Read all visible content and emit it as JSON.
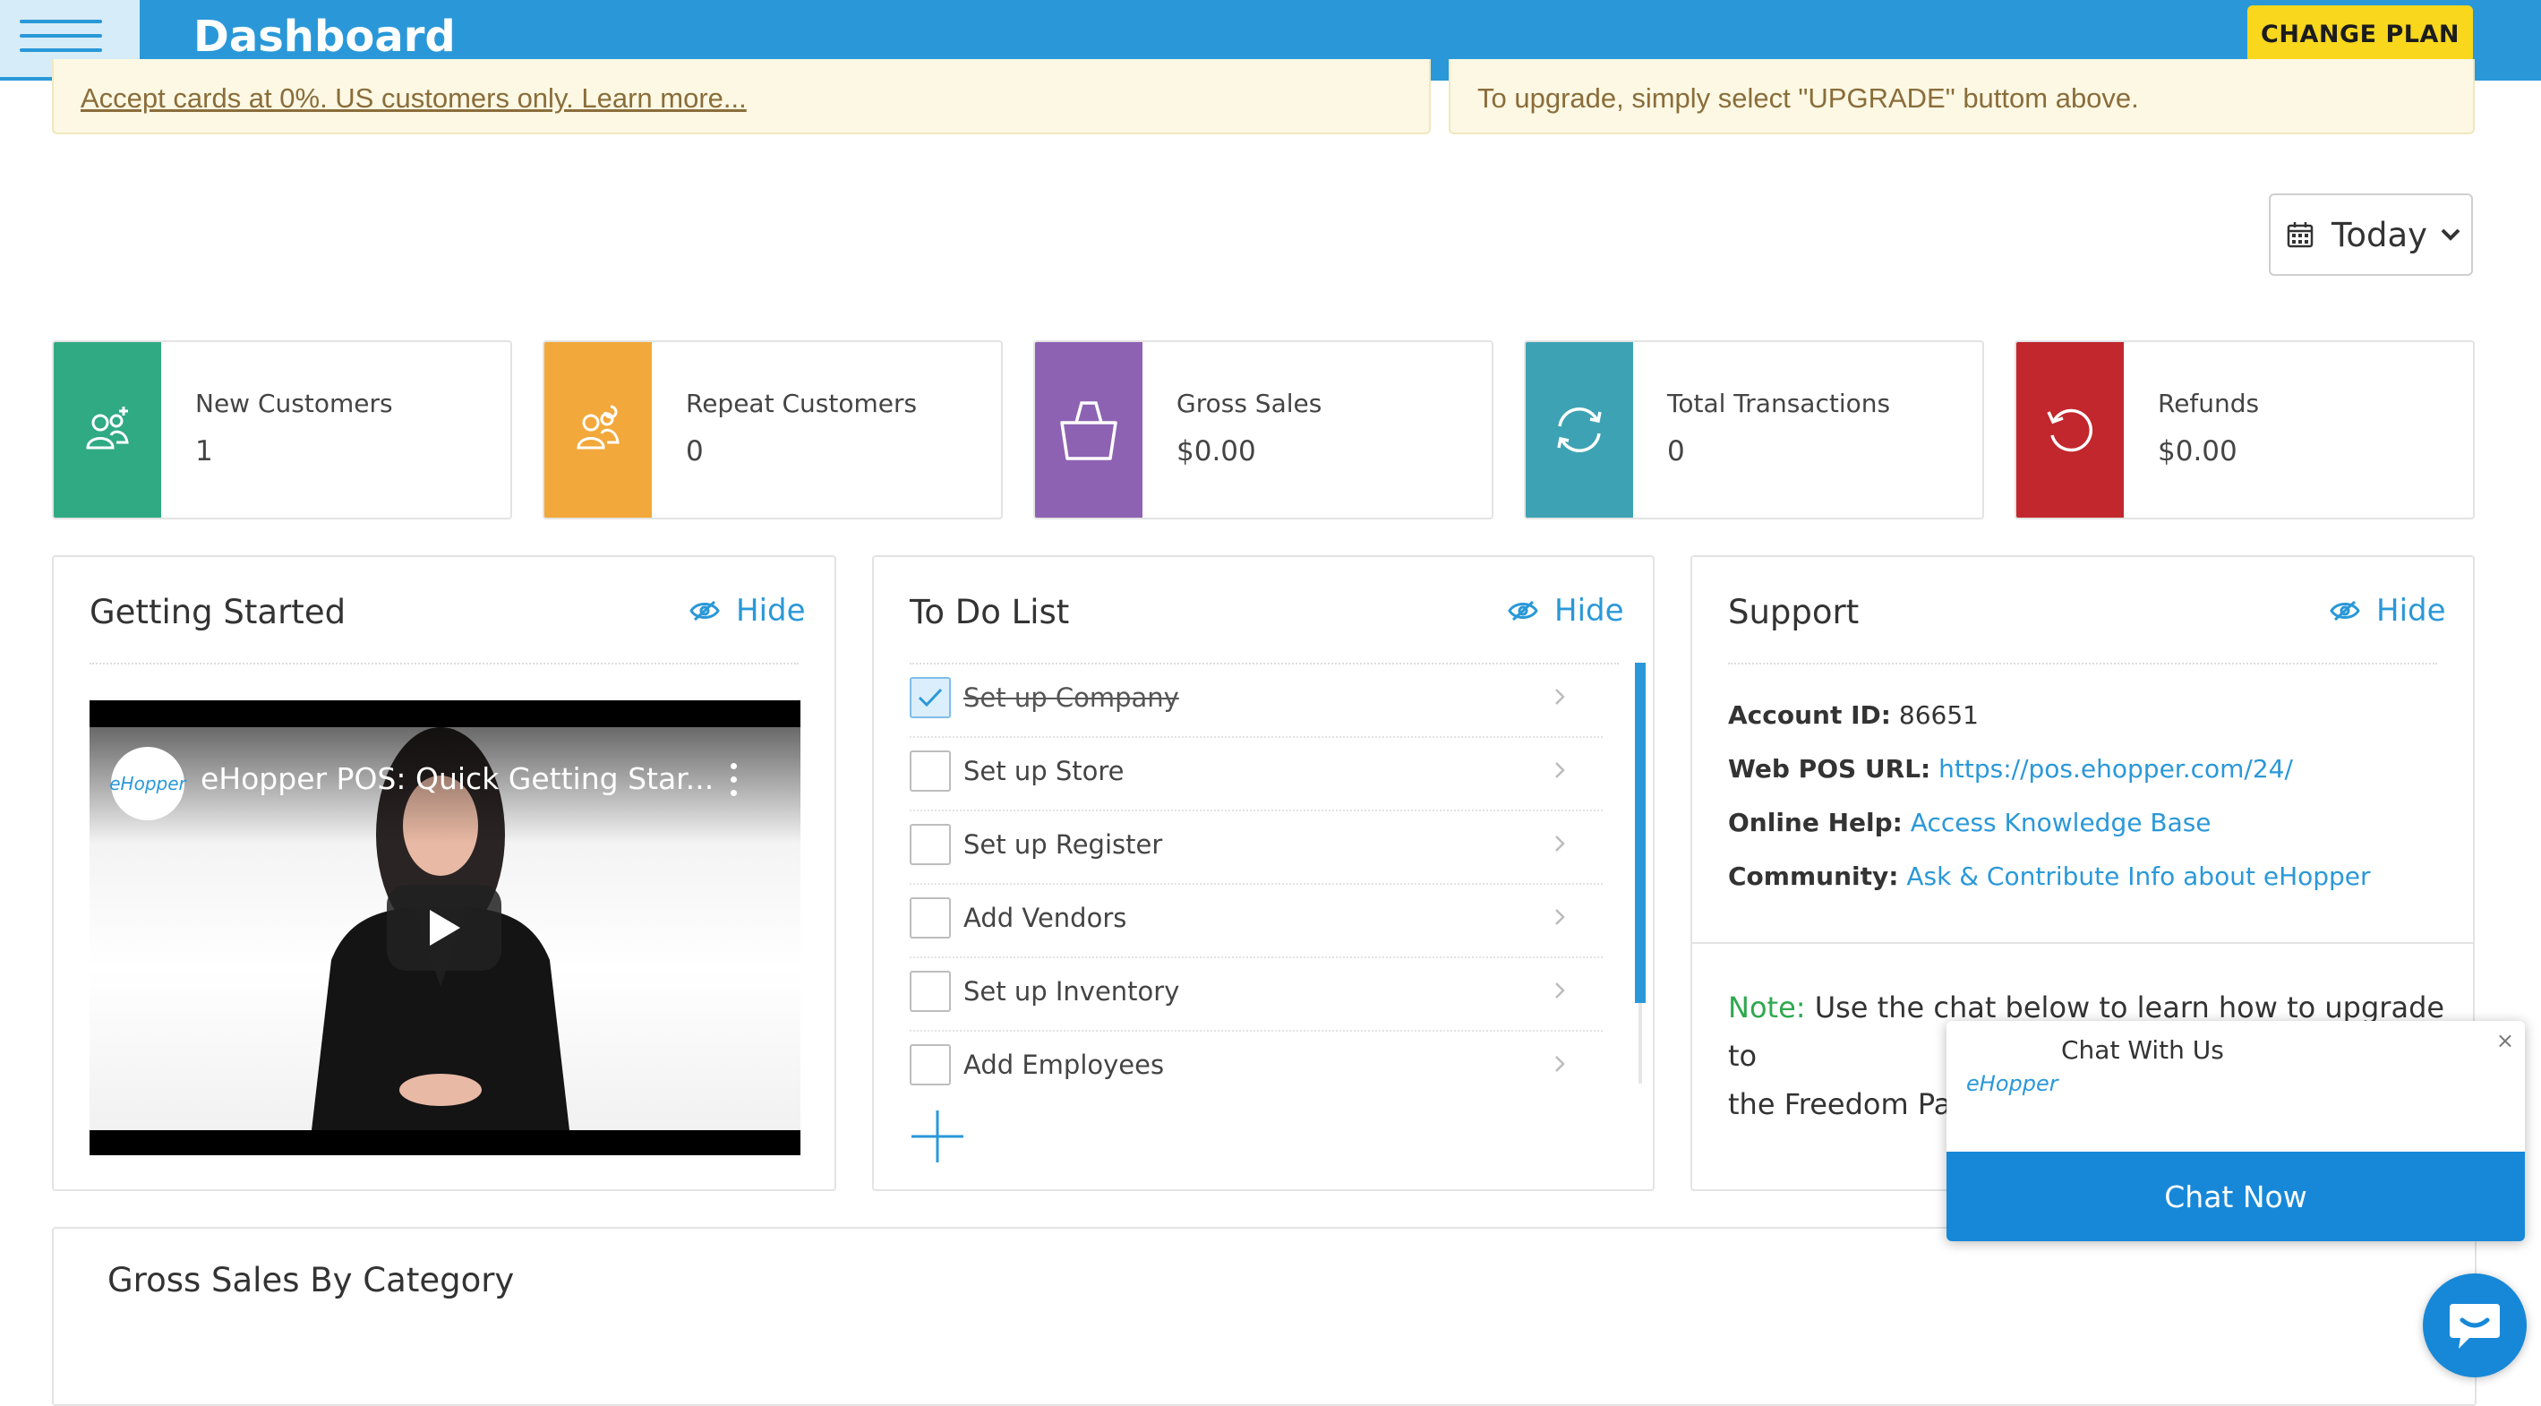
{
  "header": {
    "title": "Dashboard",
    "change_plan_label": "CHANGE PLAN",
    "menu_icon": "hamburger-icon",
    "brand_color": "#2a98d8"
  },
  "notices": {
    "left_text": "Accept cards at 0%. US customers only. Learn more...",
    "right_text": "To upgrade, simply select \"UPGRADE\" buttom above."
  },
  "date_filter": {
    "selected": "Today",
    "icon": "calendar-icon"
  },
  "stats": [
    {
      "label": "New Customers",
      "value": "1",
      "color": "#2faa83",
      "icon": "add-user-icon"
    },
    {
      "label": "Repeat Customers",
      "value": "0",
      "color": "#f2a83a",
      "icon": "users-icon"
    },
    {
      "label": "Gross Sales",
      "value": "$0.00",
      "color": "#8e62b3",
      "icon": "shopping-bag-icon"
    },
    {
      "label": "Total Transactions",
      "value": "0",
      "color": "#3da3b4",
      "icon": "refresh-icon"
    },
    {
      "label": "Refunds",
      "value": "$0.00",
      "color": "#c1272d",
      "icon": "undo-icon"
    }
  ],
  "getting_started": {
    "title": "Getting Started",
    "hide_label": "Hide",
    "video": {
      "channel_logo": "eHopper",
      "title": "eHopper POS: Quick Getting Star..."
    }
  },
  "todo": {
    "title": "To Do List",
    "hide_label": "Hide",
    "items": [
      {
        "label": "Set up Company",
        "done": true
      },
      {
        "label": "Set up Store",
        "done": false
      },
      {
        "label": "Set up Register",
        "done": false
      },
      {
        "label": "Add Vendors",
        "done": false
      },
      {
        "label": "Set up Inventory",
        "done": false
      },
      {
        "label": "Add Employees",
        "done": false
      }
    ]
  },
  "support": {
    "title": "Support",
    "hide_label": "Hide",
    "account_label": "Account ID:",
    "account_value": "86651",
    "web_pos_label": "Web POS URL:",
    "web_pos_value": "https://pos.ehopper.com/24/",
    "help_label": "Online Help:",
    "help_value": "Access Knowledge Base",
    "community_label": "Community:",
    "community_value": "Ask & Contribute Info about eHopper",
    "note_label": "Note:",
    "note_line1": "Use the chat below to learn how to upgrade to",
    "note_line2": "the Freedom Pa"
  },
  "chat": {
    "title": "Chat With Us",
    "logo": "eHopper",
    "close": "×",
    "button": "Chat Now"
  },
  "gross_sales_by_category": {
    "title": "Gross Sales By Category"
  }
}
